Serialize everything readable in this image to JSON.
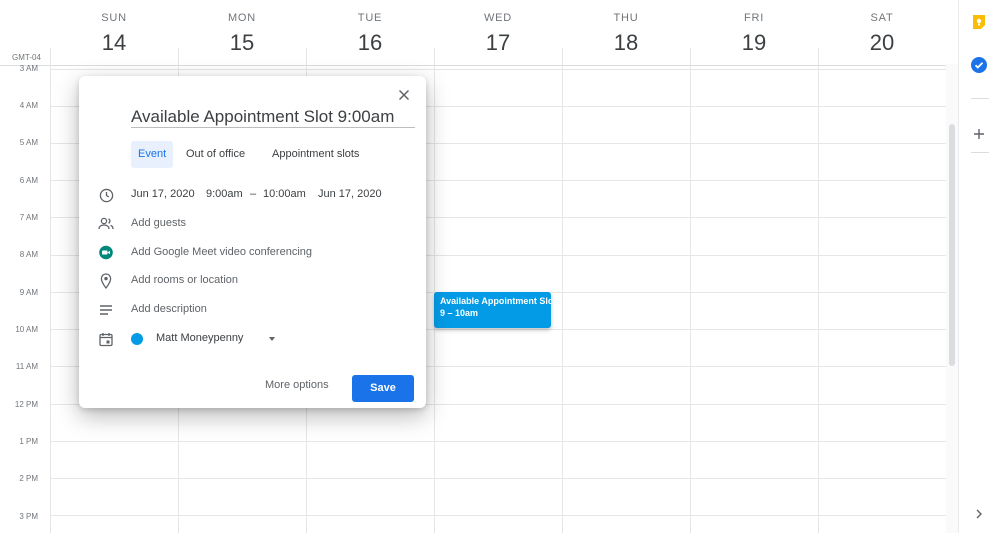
{
  "header": {
    "timezone": "GMT-04",
    "days": [
      {
        "name": "SUN",
        "num": "14"
      },
      {
        "name": "MON",
        "num": "15"
      },
      {
        "name": "TUE",
        "num": "16"
      },
      {
        "name": "WED",
        "num": "17"
      },
      {
        "name": "THU",
        "num": "18"
      },
      {
        "name": "FRI",
        "num": "19"
      },
      {
        "name": "SAT",
        "num": "20"
      }
    ]
  },
  "hours": [
    "3 AM",
    "4 AM",
    "5 AM",
    "6 AM",
    "7 AM",
    "8 AM",
    "9 AM",
    "10 AM",
    "11 AM",
    "12 PM",
    "1 PM",
    "2 PM",
    "3 PM"
  ],
  "event": {
    "title": "Available Appointment Slot",
    "time": "9 – 10am",
    "color": "#039be5"
  },
  "dialog": {
    "title_value": "Available Appointment Slot 9:00am",
    "tabs": [
      "Event",
      "Out of office",
      "Appointment slots"
    ],
    "start_date": "Jun 17, 2020",
    "start_time": "9:00am",
    "dash": "–",
    "end_time": "10:00am",
    "end_date": "Jun 17, 2020",
    "add_guests": "Add guests",
    "add_meet": "Add Google Meet video conferencing",
    "add_location": "Add rooms or location",
    "add_description": "Add description",
    "calendar_owner": "Matt Moneypenny",
    "calendar_color": "#039be5",
    "more_options": "More options",
    "save": "Save"
  },
  "colors": {
    "accent": "#1a73e8",
    "tab_active_bg": "#e8f0fe",
    "keep_yellow": "#fbbc04",
    "tasks_blue": "#1a73e8",
    "meet_green": "#00897b"
  },
  "side_icons": [
    "keep-icon",
    "tasks-icon",
    "add-icon",
    "chevron-right-icon"
  ]
}
